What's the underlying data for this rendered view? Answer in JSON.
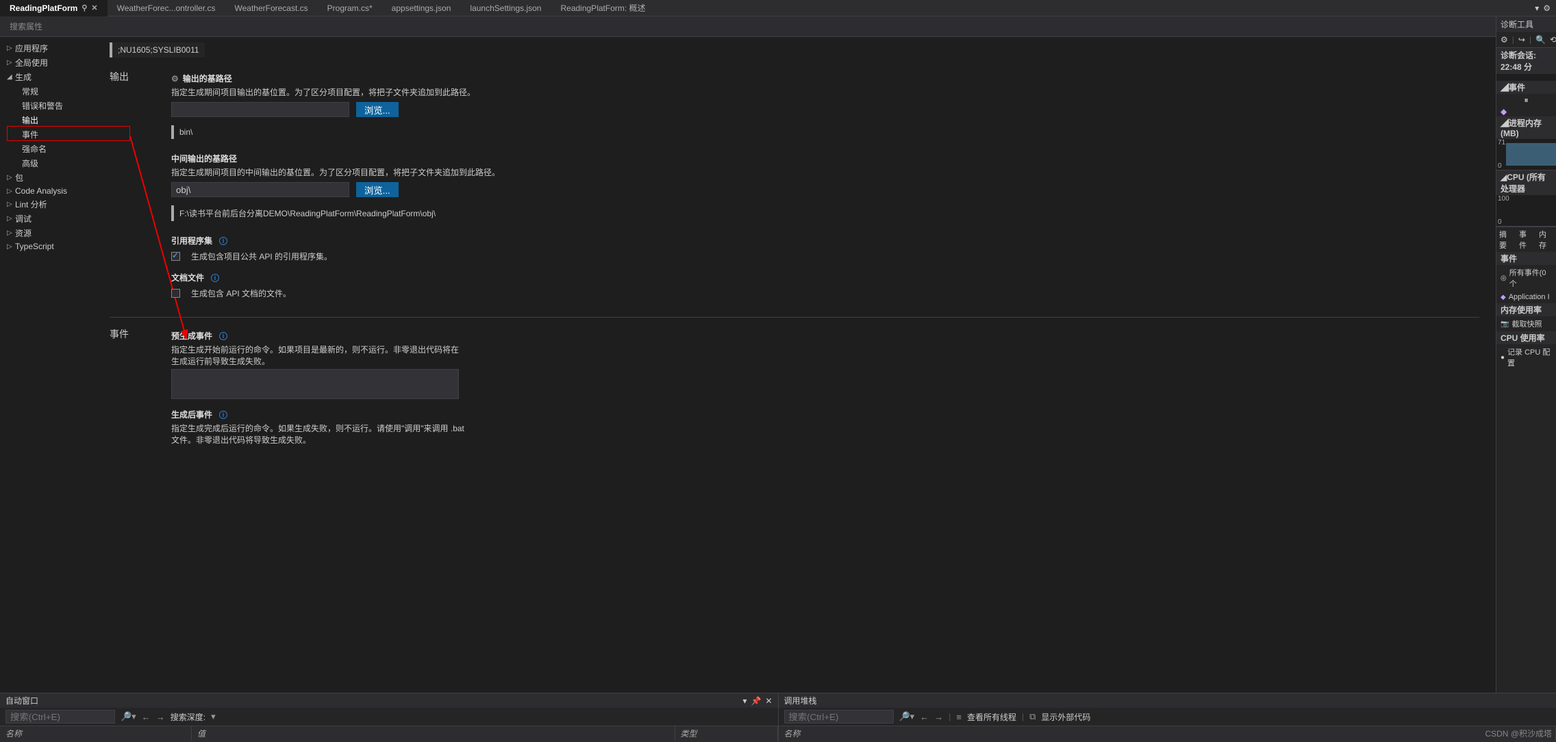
{
  "tabs": [
    {
      "label": "ReadingPlatForm",
      "active": true,
      "pinned": true,
      "closable": true
    },
    {
      "label": "WeatherForec...ontroller.cs"
    },
    {
      "label": "WeatherForecast.cs"
    },
    {
      "label": "Program.cs*"
    },
    {
      "label": "appsettings.json"
    },
    {
      "label": "launchSettings.json"
    },
    {
      "label": "ReadingPlatForm: 概述"
    }
  ],
  "search_props_placeholder": "搜索属性",
  "tree": {
    "items": [
      {
        "label": "应用程序",
        "caret": "▷"
      },
      {
        "label": "全局使用",
        "caret": "▷"
      },
      {
        "label": "生成",
        "caret": "◢",
        "expanded": true,
        "children": [
          {
            "label": "常规"
          },
          {
            "label": "错误和警告"
          },
          {
            "label": "输出",
            "selected": true
          },
          {
            "label": "事件"
          },
          {
            "label": "强命名"
          },
          {
            "label": "高级"
          }
        ]
      },
      {
        "label": "包",
        "caret": "▷"
      },
      {
        "label": "Code Analysis",
        "caret": "▷"
      },
      {
        "label": "Lint 分析",
        "caret": "▷"
      },
      {
        "label": "调试",
        "caret": "▷"
      },
      {
        "label": "资源",
        "caret": "▷"
      },
      {
        "label": "TypeScript",
        "caret": "▷"
      }
    ]
  },
  "warn_codes": ";NU1605;SYSLIB0011",
  "sections": {
    "output_title": "输出",
    "base_path": {
      "header": "输出的基路径",
      "desc": "指定生成期间项目输出的基位置。为了区分项目配置，将把子文件夹追加到此路径。",
      "browse": "浏览...",
      "value": "bin\\"
    },
    "inter_path": {
      "header": "中间输出的基路径",
      "desc": "指定生成期间项目的中间输出的基位置。为了区分项目配置，将把子文件夹追加到此路径。",
      "input": "obj\\",
      "browse": "浏览...",
      "value": "F:\\读书平台前后台分离DEMO\\ReadingPlatForm\\ReadingPlatForm\\obj\\"
    },
    "ref_asm": {
      "header": "引用程序集",
      "desc": "生成包含项目公共 API 的引用程序集。",
      "checked": true
    },
    "doc_file": {
      "header": "文档文件",
      "desc": "生成包含 API 文档的文件。",
      "checked": false
    },
    "events_title": "事件",
    "pre_build": {
      "header": "预生成事件",
      "desc": "指定生成开始前运行的命令。如果项目是最新的，则不运行。非零退出代码将在生成运行前导致生成失败。"
    },
    "post_build": {
      "header": "生成后事件",
      "desc": "指定生成完成后运行的命令。如果生成失败，则不运行。请使用\"调用\"来调用 .bat 文件。非零退出代码将导致生成失败。"
    }
  },
  "diag": {
    "title": "诊断工具",
    "session": "诊断会话: 22:48 分",
    "events_hdr": "◢事件",
    "mem_hdr": "◢进程内存 (MB)",
    "mem_axis": {
      "top": "71",
      "bottom": "0"
    },
    "cpu_hdr": "◢CPU (所有处理器",
    "cpu_axis": {
      "top": "100",
      "bottom": "0"
    },
    "tabs": [
      "摘要",
      "事件",
      "内存"
    ],
    "events_section": "事件",
    "all_events": "所有事件(0 个",
    "app": "Application I",
    "mem_usage": "内存使用率",
    "snapshot": "截取快照",
    "cpu_usage": "CPU 使用率",
    "record": "记录 CPU 配置"
  },
  "bottom": {
    "autos_title": "自动窗口",
    "search_placeholder": "搜索(Ctrl+E)",
    "depth_label": "搜索深度:",
    "col_name": "名称",
    "col_value": "值",
    "col_type": "类型",
    "callstack_title": "调用堆栈",
    "callstack_flags": {
      "threads": "查看所有线程",
      "external": "显示外部代码"
    }
  },
  "watermark": "CSDN @积沙成塔"
}
